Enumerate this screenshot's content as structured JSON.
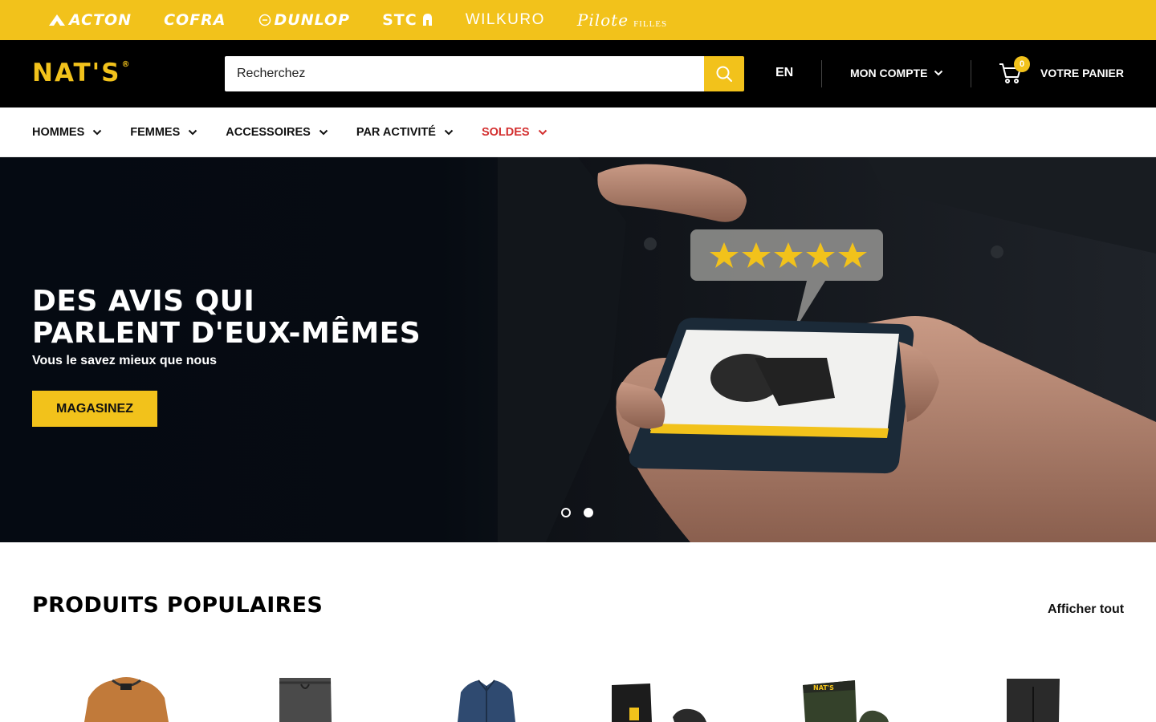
{
  "brands": [
    {
      "name": "ACTON"
    },
    {
      "name": "COFRA"
    },
    {
      "name": "DUNLOP"
    },
    {
      "name": "STC"
    },
    {
      "name": "WILKURO"
    },
    {
      "name": "Pilote",
      "sub": "FILLES"
    }
  ],
  "header": {
    "logo": "NAT'S",
    "logo_mark": "®",
    "search_placeholder": "Recherchez",
    "language": "EN",
    "account_label": "MON COMPTE",
    "cart_count": "0",
    "cart_label": "VOTRE PANIER"
  },
  "nav": {
    "items": [
      {
        "label": "HOMMES"
      },
      {
        "label": "FEMMES"
      },
      {
        "label": "ACCESSOIRES"
      },
      {
        "label": "PAR ACTIVITÉ"
      },
      {
        "label": "SOLDES"
      }
    ]
  },
  "hero": {
    "title_line1": "DES AVIS QUI",
    "title_line2": "PARLENT D'EUX-MÊMES",
    "subtitle": "Vous le savez mieux que nous",
    "button": "MAGASINEZ",
    "rating_stars": 5,
    "slides_total": 2,
    "slide_active": 1
  },
  "popular": {
    "title": "PRODUITS POPULAIRES",
    "view_all": "Afficher tout"
  },
  "colors": {
    "accent": "#f2c21b",
    "header_bg": "#000000",
    "sale": "#d32f2f"
  }
}
